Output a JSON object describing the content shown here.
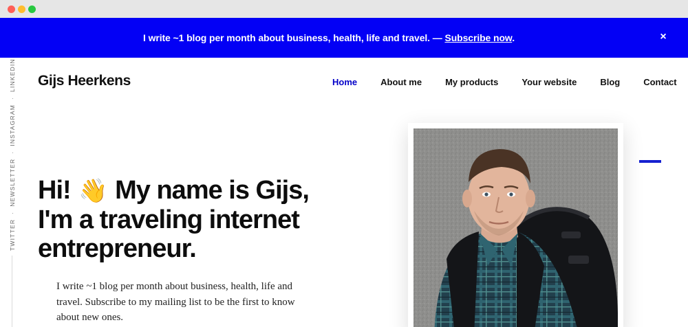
{
  "announcement": {
    "text": "I write ~1 blog per month about business, health, life and travel. — ",
    "link": "Subscribe now",
    "suffix": ".",
    "close": "×"
  },
  "social": [
    "Twitter",
    "Newsletter",
    "Instagram",
    "LinkedIn"
  ],
  "header": {
    "brand": "Gijs Heerkens",
    "nav": [
      "Home",
      "About me",
      "My products",
      "Your website",
      "Blog",
      "Contact"
    ]
  },
  "hero": {
    "line1a": "Hi!",
    "wave": "👋",
    "line1b": "My name is Gijs,",
    "line2": "I'm a traveling internet",
    "line3": "entrepreneur.",
    "text": "I write ~1 blog per month about business, health, life and travel. Subscribe to my mailing list to be the first to know about new ones."
  },
  "colors": {
    "accent": "#0300f5",
    "nav_active": "#0300c8"
  }
}
